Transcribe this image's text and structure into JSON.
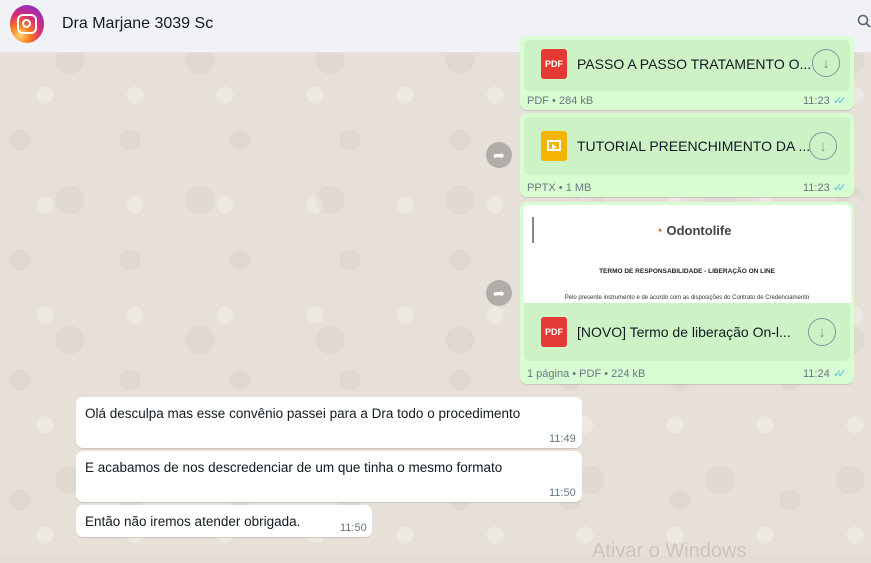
{
  "header": {
    "contact_name": "Dra Marjane 3039 Sc",
    "avatar_icon": "instagram-logo-icon",
    "search_icon": "search-icon"
  },
  "messages": [
    {
      "type": "document",
      "file_icon": "PDF",
      "filename": "PASSO A PASSO TRATAMENTO O...",
      "meta": "PDF • 284 kB",
      "time": "11:23"
    },
    {
      "type": "document",
      "file_icon": "pptx-icon",
      "filename": "TUTORIAL PREENCHIMENTO DA ...",
      "meta": "PPTX • 1 MB",
      "time": "11:23"
    },
    {
      "type": "document",
      "file_icon": "PDF",
      "filename": "[NOVO] Termo de liberação On-l...",
      "meta": "1 página • PDF • 224 kB",
      "time": "11:24",
      "preview": {
        "logo": "Odontolife",
        "title": "TERMO DE RESPONSABILIDADE - LIBERAÇÃO ON LINE",
        "line": "Pelo presente instrumento e de acordo com as disposições do Contrato de Credenciamento"
      }
    },
    {
      "type": "text",
      "text": "Olá desculpa mas esse convênio passei para a Dra todo o procedimento",
      "time": "11:49"
    },
    {
      "type": "text",
      "text": "E acabamos de nos descredenciar de um que tinha o mesmo formato",
      "time": "11:50"
    },
    {
      "type": "text",
      "text": "Então não iremos atender obrigada.",
      "time": "11:50"
    }
  ],
  "colors": {
    "outgoing": "#d9fdd3",
    "incoming": "#ffffff",
    "read_ticks": "#53bdeb",
    "header_bg": "#f0f2f5"
  },
  "watermark": "Ativar o Windows"
}
